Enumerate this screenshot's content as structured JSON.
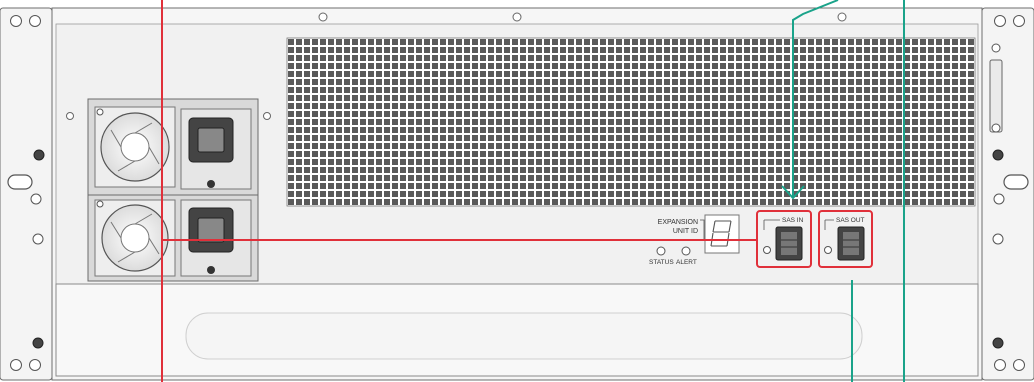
{
  "panel": {
    "expansion_label_line1": "EXPANSION",
    "expansion_label_line2": "UNIT ID",
    "status_label": "STATUS",
    "alert_label": "ALERT",
    "sas_in_label": "SAS IN",
    "sas_out_label": "SAS OUT"
  },
  "colors": {
    "callout_red": "#e0303a",
    "callout_teal": "#1aa38a",
    "chassis": "#f4f4f4",
    "chassis_stroke": "#6e6e6e",
    "vent_hole": "#5a5a5a",
    "vent_bg": "#ffffff"
  },
  "icons": [
    "rack-screw-icon",
    "rack-ear-slot-icon",
    "power-supply-fan-icon",
    "power-inlet-icon",
    "sas-port-icon",
    "led-indicator-icon",
    "seven-segment-display-icon"
  ]
}
